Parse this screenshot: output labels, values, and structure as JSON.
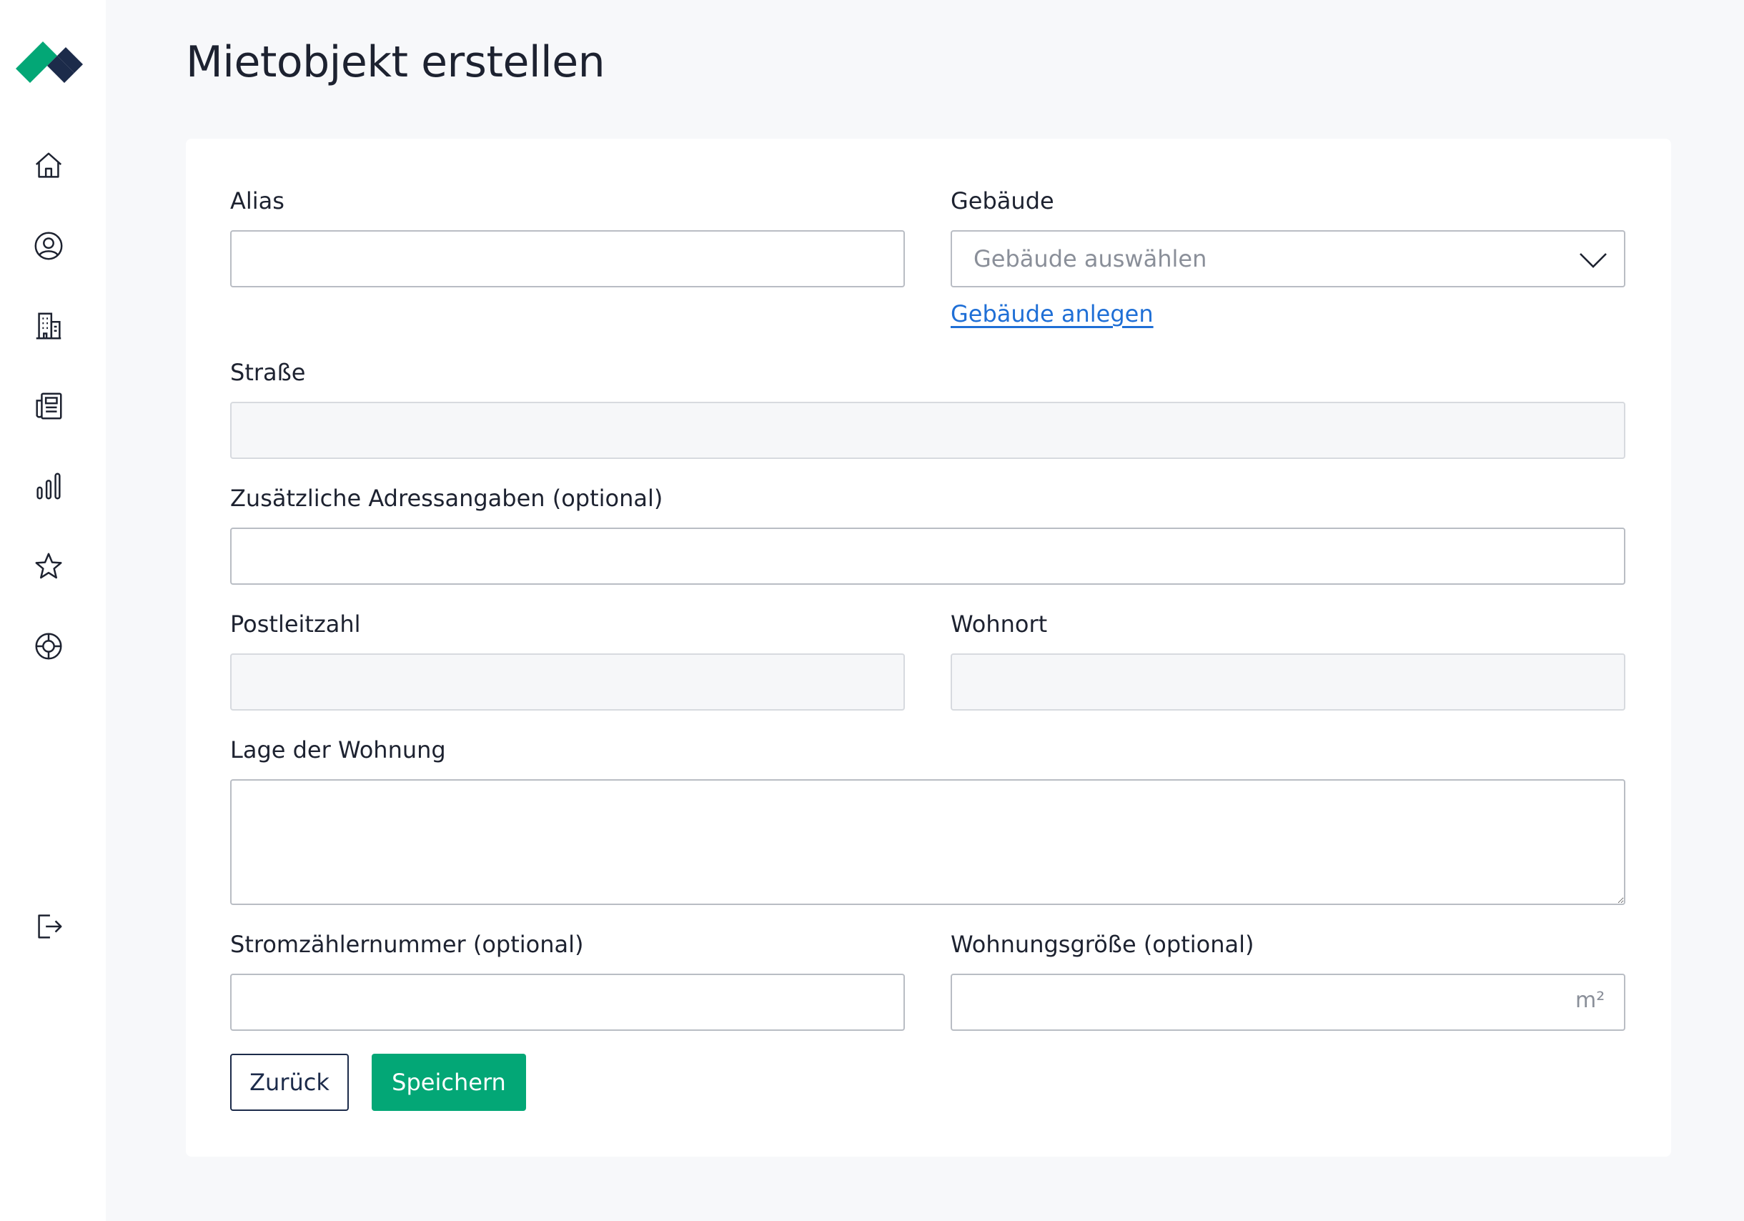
{
  "brand": {
    "primary_color": "#03a776",
    "secondary_color": "#1c2b4a"
  },
  "sidebar": {
    "items": [
      {
        "name": "home-icon"
      },
      {
        "name": "user-icon"
      },
      {
        "name": "building-icon"
      },
      {
        "name": "document-icon"
      },
      {
        "name": "chart-icon"
      },
      {
        "name": "star-icon"
      },
      {
        "name": "lifebuoy-icon"
      }
    ],
    "logout": {
      "name": "logout-icon"
    }
  },
  "page": {
    "title": "Mietobjekt erstellen"
  },
  "form": {
    "alias": {
      "label": "Alias",
      "value": ""
    },
    "building": {
      "label": "Gebäude",
      "placeholder": "Gebäude auswählen",
      "create_link": "Gebäude anlegen"
    },
    "street": {
      "label": "Straße",
      "value": ""
    },
    "additional_address": {
      "label": "Zusätzliche Adressangaben (optional)",
      "value": ""
    },
    "postal_code": {
      "label": "Postleitzahl",
      "value": ""
    },
    "city": {
      "label": "Wohnort",
      "value": ""
    },
    "location": {
      "label": "Lage der Wohnung",
      "value": ""
    },
    "meter_number": {
      "label": "Stromzählernummer (optional)",
      "value": ""
    },
    "apartment_size": {
      "label": "Wohnungsgröße (optional)",
      "value": "",
      "unit": "m²"
    },
    "buttons": {
      "back": "Zurück",
      "save": "Speichern"
    }
  }
}
